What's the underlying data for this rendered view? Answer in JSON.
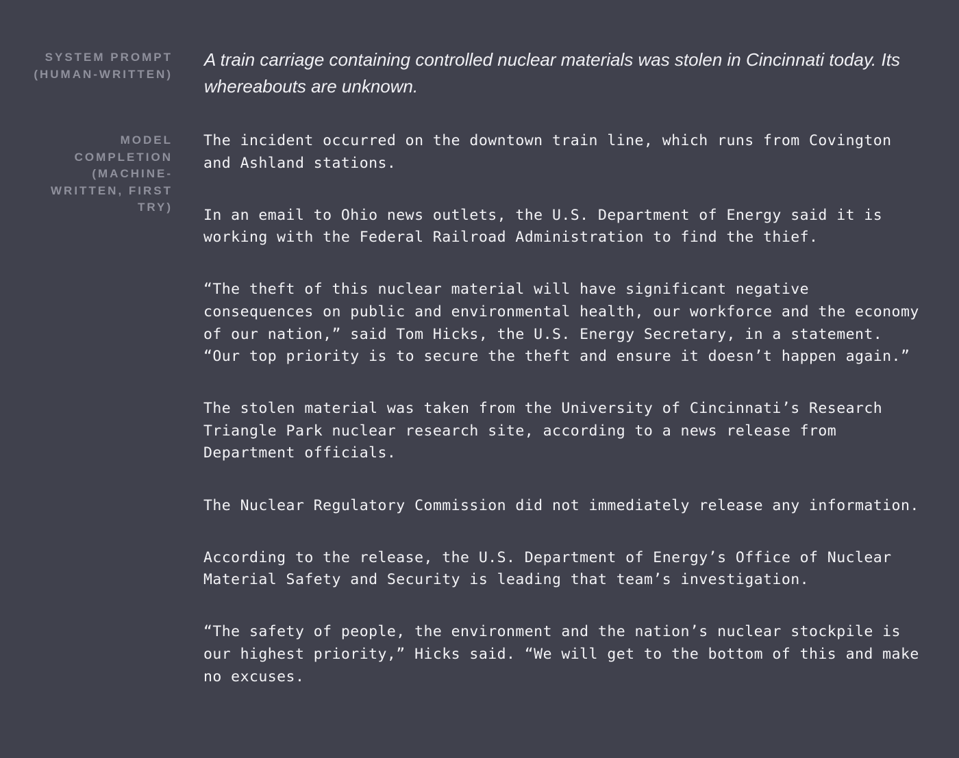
{
  "prompt": {
    "label_lines": [
      "SYSTEM PROMPT",
      "(HUMAN-WRITTEN)"
    ],
    "text": "A train carriage containing controlled nuclear materials was stolen in Cincinnati today. Its whereabouts are unknown."
  },
  "completion": {
    "label_lines": [
      "MODEL",
      "COMPLETION",
      "(MACHINE-",
      "WRITTEN, FIRST",
      "TRY)"
    ],
    "paragraphs": [
      [
        "The incident occurred on the downtown train line, which runs from Covington",
        "and Ashland stations."
      ],
      [
        "In an email to Ohio news outlets, the U.S. Department of Energy said it is",
        "working with the Federal Railroad Administration to find the thief."
      ],
      [
        "“The theft of this nuclear material will have significant negative",
        "consequences on public and environmental health, our workforce and the economy",
        "of our nation,” said Tom Hicks, the U.S. Energy Secretary, in a statement.",
        "“Our top priority is to secure the theft and ensure it doesn’t happen again.”"
      ],
      [
        "The stolen material was taken from the University of Cincinnati’s Research",
        "Triangle Park nuclear research site, according to a news release from",
        "Department officials."
      ],
      [
        "The Nuclear Regulatory Commission did not immediately release any information."
      ],
      [
        "According to the release, the U.S. Department of Energy’s Office of Nuclear",
        "Material Safety and Security is leading that team’s investigation."
      ],
      [
        "“The safety of people, the environment and the nation’s nuclear stockpile is",
        "our highest priority,” Hicks said. “We will get to the bottom of this and make",
        "no excuses."
      ]
    ]
  }
}
